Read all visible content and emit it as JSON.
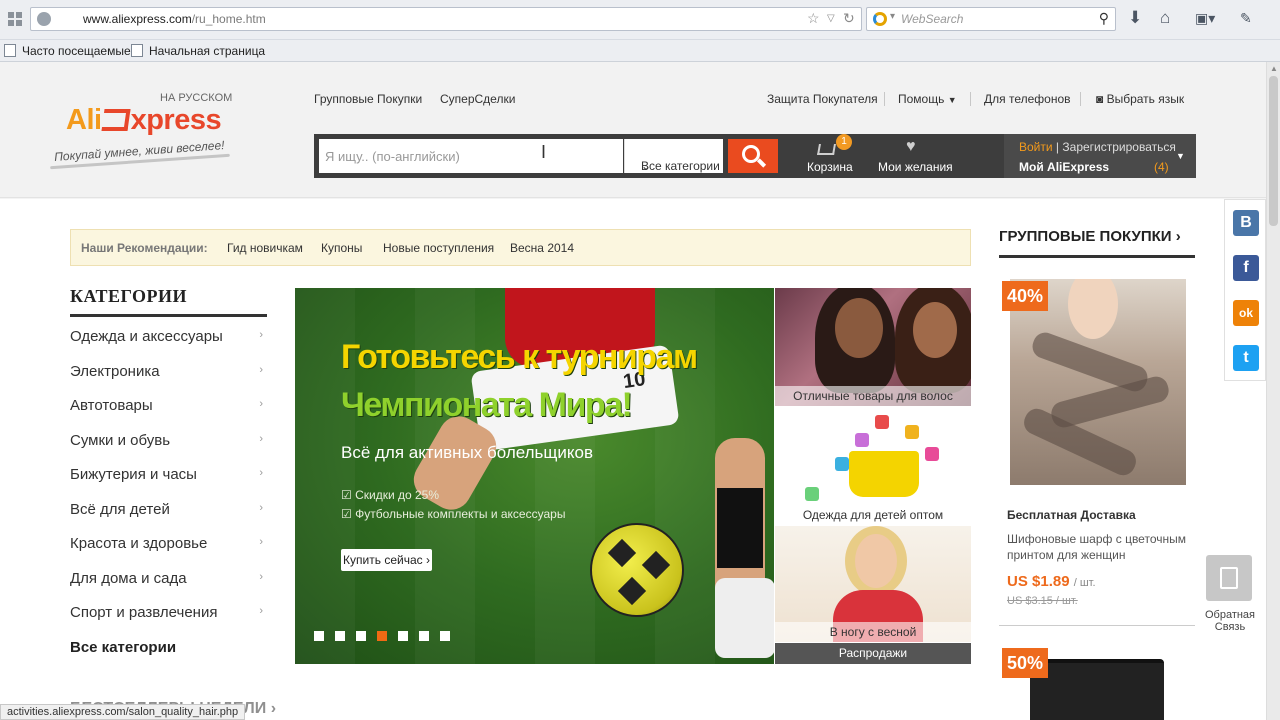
{
  "browser": {
    "url_prefix": "www.aliexpress.com",
    "url_path": "/ru_home.htm",
    "search_engine_placeholder": "WebSearch",
    "bookmarks": [
      "Часто посещаемые",
      "Начальная страница"
    ],
    "status_url": "activities.aliexpress.com/salon_quality_hair.php"
  },
  "header": {
    "logo_tagline_lang": "НА РУССКОМ",
    "logo_ali": "Ali",
    "logo_express": "xpress",
    "slogan": "Покупай умнее, живи веселее!",
    "nav_left": [
      "Групповые Покупки",
      "СуперСделки"
    ],
    "nav_right": {
      "protection": "Защита Покупателя",
      "help": "Помощь",
      "phones": "Для телефонов",
      "language": "Выбрать язык"
    },
    "search": {
      "placeholder": "Я ищу.. (по-английски)",
      "category": "Все категории",
      "cart_label": "Корзина",
      "cart_count": "1",
      "wishlist_label": "Мои желания"
    },
    "account": {
      "login": "Войти",
      "register": "Зарегистрироваться",
      "my": "Мой AliExpress",
      "count": "(4)"
    }
  },
  "recommendations": {
    "title": "Наши Рекомендации:",
    "links": [
      "Гид новичкам",
      "Купоны",
      "Новые поступления",
      "Весна 2014"
    ]
  },
  "categories": {
    "title": "КАТЕГОРИИ",
    "items": [
      "Одежда и аксессуары",
      "Электроника",
      "Автотовары",
      "Сумки и обувь",
      "Бижутерия и часы",
      "Всё для детей",
      "Красота и здоровье",
      "Для дома и сада",
      "Спорт и развлечения"
    ],
    "all": "Все категории"
  },
  "banner": {
    "line1": "Готовьтесь к турнирам",
    "line2": "Чемпионата Мира!",
    "subtitle": "Всё для активных болельщиков",
    "bullets": [
      "☑ Скидки до 25%",
      "☑ Футбольные комплекты и аксессуары"
    ],
    "button": "Купить сейчас ›",
    "jersey_number": "10",
    "slides": 7,
    "active_slide": 4
  },
  "promos": {
    "hair": "Отличные товары для волос",
    "kids": "Одежда для детей оптом",
    "spring": "В ногу с весной",
    "sales": "Распродажи"
  },
  "group_buy": {
    "title": "ГРУППОВЫЕ ПОКУПКИ ›",
    "deal1": {
      "discount": "40%",
      "shipping": "Бесплатная Доставка",
      "name": "Шифоновые шарф с цветочным принтом для женщин",
      "price": "US $1.89",
      "unit": "/ шт.",
      "old_price": "US $3.15 / шт."
    },
    "deal2": {
      "discount": "50%"
    }
  },
  "social": {
    "vk": "B",
    "fb": "f",
    "ok": "ok",
    "tw": "t"
  },
  "feedback": "Обратная Связь",
  "bottom_heading": "БЕСТСЕЛЛЕРЫ НЕДЕЛИ ›",
  "colors": {
    "accent": "#ea4b1f",
    "brand_orange": "#f39a1c",
    "vk": "#4a76a8",
    "fb": "#3b5998",
    "ok": "#ee8208",
    "tw": "#1da1f2"
  }
}
